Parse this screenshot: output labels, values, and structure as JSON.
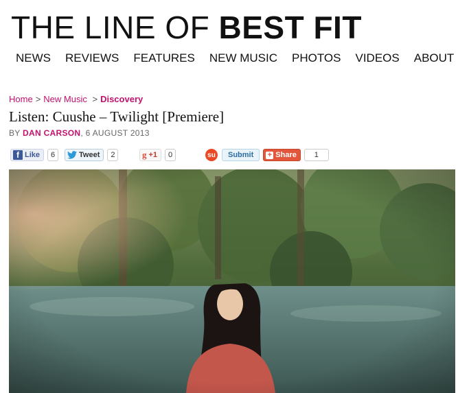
{
  "site": {
    "logo_thin": "THE LINE OF",
    "logo_bold": "BEST FIT"
  },
  "nav": {
    "items": [
      "NEWS",
      "REVIEWS",
      "FEATURES",
      "NEW MUSIC",
      "PHOTOS",
      "VIDEOS",
      "ABOUT"
    ]
  },
  "breadcrumb": {
    "home": "Home",
    "sep": ">",
    "section": "New Music",
    "current": "Discovery"
  },
  "article": {
    "title": "Listen: Cuushe – Twilight [Premiere]",
    "by": "BY",
    "author": "DAN CARSON",
    "date": ", 6 AUGUST 2013"
  },
  "share": {
    "facebook_label": "Like",
    "facebook_count": "6",
    "twitter_label": "Tweet",
    "twitter_count": "2",
    "gplus_label": "+1",
    "gplus_count": "0",
    "stumble_label": "Submit",
    "share_label": "Share",
    "share_count": "1"
  },
  "colors": {
    "accent": "#c0126e",
    "facebook": "#3b5998",
    "stumbleupon": "#eb4924",
    "share": "#e2563c"
  },
  "icons": [
    "facebook-icon",
    "twitter-icon",
    "google-plus-icon",
    "stumbleupon-icon",
    "plus-icon"
  ]
}
